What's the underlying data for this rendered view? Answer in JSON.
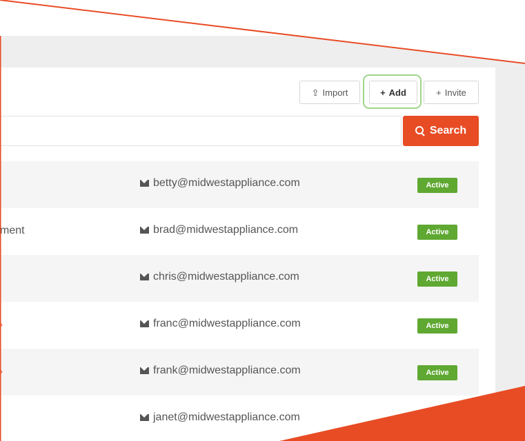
{
  "toolbar": {
    "import_label": "Import",
    "add_label": "Add",
    "invite_label": "Invite",
    "search_label": "Search"
  },
  "search": {
    "value": "",
    "placeholder": ""
  },
  "users": [
    {
      "name_fragment": "",
      "email": "betty@midwestappliance.com",
      "status": "Active"
    },
    {
      "name_fragment": "ment",
      "email": "brad@midwestappliance.com",
      "status": "Active"
    },
    {
      "name_fragment": "",
      "email": "chris@midwestappliance.com",
      "status": "Active"
    },
    {
      "name_fragment": "",
      "email": "franc@midwestappliance.com",
      "status": "Active"
    },
    {
      "name_fragment": "",
      "email": "frank@midwestappliance.com",
      "status": "Active"
    },
    {
      "name_fragment": "",
      "email": "janet@midwestappliance.com",
      "status": ""
    }
  ],
  "icons": {
    "import": "upload-icon",
    "add": "plus-icon",
    "invite": "plus-icon",
    "search": "search-icon",
    "email": "envelope-icon"
  },
  "colors": {
    "accent": "#e84c25",
    "status_active": "#5fa832",
    "highlight": "#9fd48a"
  }
}
